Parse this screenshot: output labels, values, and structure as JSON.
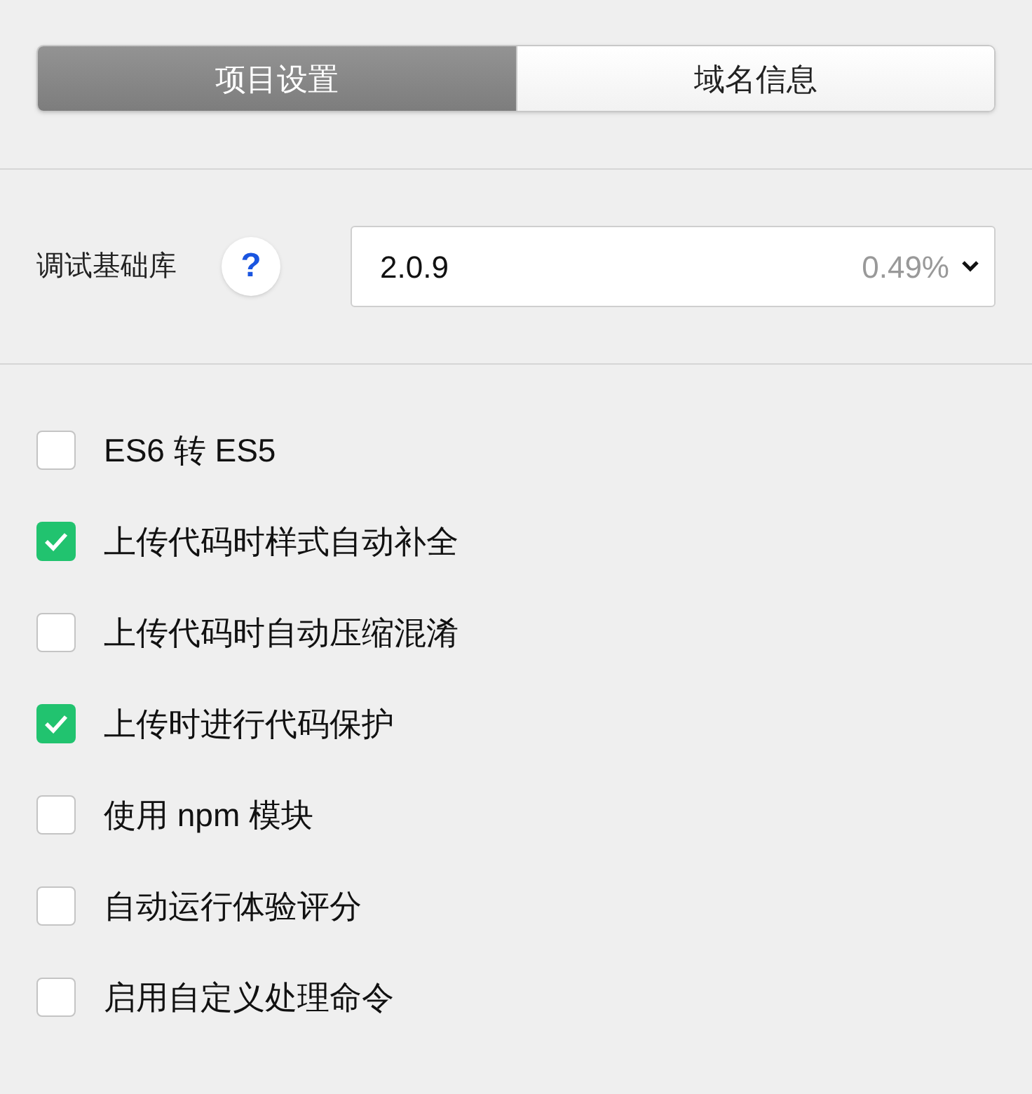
{
  "tabs": [
    {
      "label": "项目设置",
      "selected": true
    },
    {
      "label": "域名信息",
      "selected": false
    }
  ],
  "library": {
    "label": "调试基础库",
    "help": "?",
    "value": "2.0.9",
    "share": "0.49%"
  },
  "options": [
    {
      "label": "ES6 转 ES5",
      "checked": false
    },
    {
      "label": "上传代码时样式自动补全",
      "checked": true
    },
    {
      "label": "上传代码时自动压缩混淆",
      "checked": false
    },
    {
      "label": "上传时进行代码保护",
      "checked": true
    },
    {
      "label": "使用 npm 模块",
      "checked": false
    },
    {
      "label": "自动运行体验评分",
      "checked": false
    },
    {
      "label": "启用自定义处理命令",
      "checked": false
    }
  ]
}
